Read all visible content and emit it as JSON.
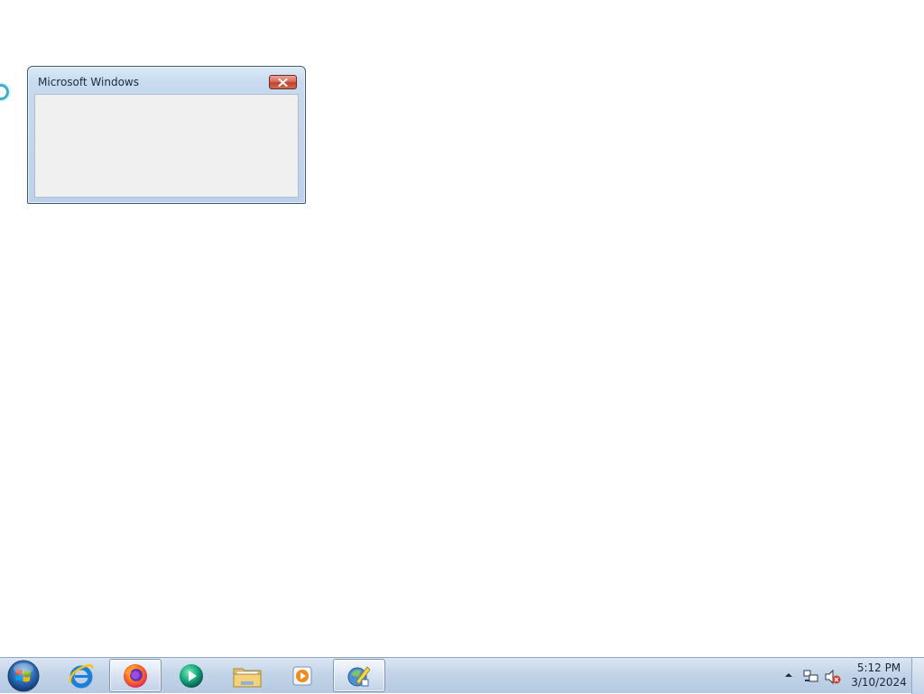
{
  "dialog": {
    "title": "Microsoft Windows",
    "close_icon": "close-icon"
  },
  "taskbar": {
    "start": "windows-start-orb-icon",
    "pinned": [
      {
        "name": "internet-explorer",
        "icon": "internet-explorer-icon",
        "active": false
      },
      {
        "name": "firefox",
        "icon": "firefox-icon",
        "active": true
      },
      {
        "name": "media-center",
        "icon": "media-center-icon",
        "active": false
      },
      {
        "name": "file-explorer",
        "icon": "folder-icon",
        "active": false
      },
      {
        "name": "media-player",
        "icon": "media-player-icon",
        "active": false
      },
      {
        "name": "installer",
        "icon": "installer-icon",
        "active": true
      }
    ],
    "tray": {
      "icons": [
        "chevron-up-icon",
        "network-icon",
        "volume-muted-icon"
      ],
      "time": "5:12 PM",
      "date": "3/10/2024"
    }
  },
  "colors": {
    "desktop": "#ffffff",
    "taskbar": "#c3d4e8",
    "dialog_frame": "#bcd2ea",
    "dialog_client": "#f0f0f0",
    "close_button": "#c1412c"
  }
}
